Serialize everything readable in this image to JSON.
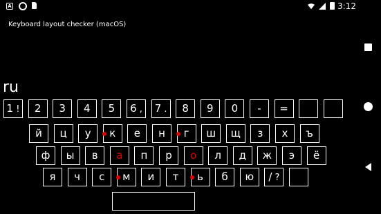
{
  "status_bar": {
    "time": "3:12",
    "left_icons": [
      "notification-a-icon",
      "record-icon",
      "sd-card-icon"
    ],
    "right_icons": [
      "wifi-icon",
      "signal-icon",
      "battery-icon"
    ]
  },
  "app_title": "Keyboard layout checker (macOS)",
  "layout_name": "ru",
  "nav": [
    "overview-square-icon",
    "home-circle-icon",
    "back-triangle-icon"
  ],
  "colors": {
    "background": "#000000",
    "foreground": "#ffffff",
    "marker": "#e00000"
  },
  "rows": [
    [
      {
        "label": "1",
        "secondary": "!"
      },
      {
        "label": "2"
      },
      {
        "label": "3"
      },
      {
        "label": "4"
      },
      {
        "label": "5"
      },
      {
        "label": "6",
        "secondary": ","
      },
      {
        "label": "7",
        "secondary": "."
      },
      {
        "label": "8"
      },
      {
        "label": "9"
      },
      {
        "label": "0"
      },
      {
        "label": "-"
      },
      {
        "label": "="
      },
      {
        "label": ""
      },
      {
        "label": ""
      }
    ],
    [
      {
        "label": "й"
      },
      {
        "label": "ц"
      },
      {
        "label": "у"
      },
      {
        "label": "к",
        "marker": "dot"
      },
      {
        "label": "е"
      },
      {
        "label": "н"
      },
      {
        "label": "г",
        "marker": "dot"
      },
      {
        "label": "ш"
      },
      {
        "label": "щ"
      },
      {
        "label": "з"
      },
      {
        "label": "х"
      },
      {
        "label": "ъ"
      }
    ],
    [
      {
        "label": "ф"
      },
      {
        "label": "ы"
      },
      {
        "label": "в"
      },
      {
        "label": "а",
        "marker": "red-text"
      },
      {
        "label": "п"
      },
      {
        "label": "р"
      },
      {
        "label": "о",
        "marker": "red-text"
      },
      {
        "label": "л"
      },
      {
        "label": "д"
      },
      {
        "label": "ж"
      },
      {
        "label": "э"
      },
      {
        "label": "ё"
      }
    ],
    [
      {
        "label": "я"
      },
      {
        "label": "ч"
      },
      {
        "label": "с"
      },
      {
        "label": "м",
        "marker": "dot"
      },
      {
        "label": "и"
      },
      {
        "label": "т"
      },
      {
        "label": "ь",
        "marker": "dot"
      },
      {
        "label": "б"
      },
      {
        "label": "ю"
      },
      {
        "label": "/",
        "secondary": "?"
      },
      {
        "label": ""
      }
    ],
    [
      {
        "label": ""
      }
    ]
  ]
}
